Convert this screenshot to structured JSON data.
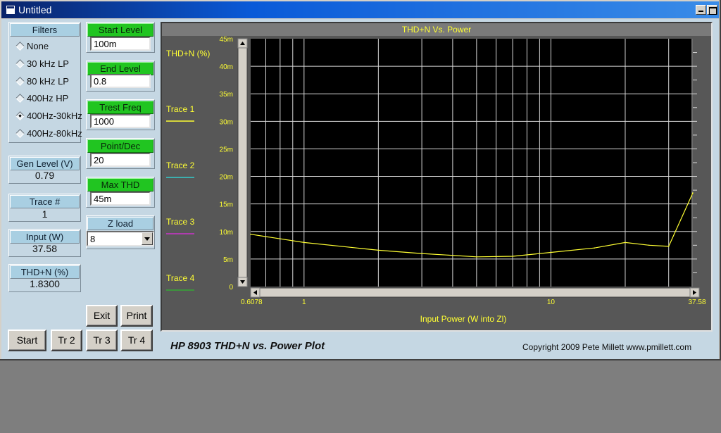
{
  "window": {
    "title": "Untitled"
  },
  "filters": {
    "label": "Filters",
    "options": [
      {
        "label": "None",
        "selected": false
      },
      {
        "label": "30 kHz LP",
        "selected": false
      },
      {
        "label": "80 kHz LP",
        "selected": false
      },
      {
        "label": "400Hz HP",
        "selected": false
      },
      {
        "label": "400Hz-30kHz",
        "selected": true
      },
      {
        "label": "400Hz-80kHz",
        "selected": false
      }
    ]
  },
  "readouts": {
    "gen_level": {
      "label": "Gen Level (V)",
      "value": "0.79"
    },
    "trace_num": {
      "label": "Trace #",
      "value": "1"
    },
    "input_w": {
      "label": "Input (W)",
      "value": "37.58"
    },
    "thdn": {
      "label": "THD+N (%)",
      "value": "1.8300"
    }
  },
  "params": {
    "start_level": {
      "label": "Start Level",
      "value": "100m"
    },
    "end_level": {
      "label": "End Level",
      "value": "0.8"
    },
    "test_freq": {
      "label": "Trest Freq",
      "value": "1000"
    },
    "point_dec": {
      "label": "Point/Dec",
      "value": "20"
    },
    "max_thd": {
      "label": "Max THD",
      "value": "45m"
    },
    "z_load": {
      "label": "Z load",
      "value": "8"
    }
  },
  "buttons": {
    "exit": "Exit",
    "print": "Print",
    "start": "Start",
    "tr2": "Tr 2",
    "tr3": "Tr 3",
    "tr4": "Tr 4"
  },
  "footer": {
    "title": "HP 8903 THD+N vs. Power Plot",
    "copyright": "Copyright 2009 Pete Millett    www.pmillett.com"
  },
  "chart_data": {
    "type": "line",
    "title": "THD+N Vs. Power",
    "ylabel": "THD+N (%)",
    "xlabel": "Input Power (W into Zl)",
    "x_scale": "log",
    "xlim": [
      0.6078,
      37.58
    ],
    "ylim": [
      0,
      45
    ],
    "y_ticks": [
      "0",
      "5m",
      "10m",
      "15m",
      "20m",
      "25m",
      "30m",
      "35m",
      "40m",
      "45m"
    ],
    "x_tick_labels": [
      {
        "value": 0.6078,
        "label": "0.6078"
      },
      {
        "value": 1,
        "label": "1"
      },
      {
        "value": 10,
        "label": "10"
      },
      {
        "value": 37.58,
        "label": "37.58"
      }
    ],
    "grid": true,
    "legend": [
      {
        "name": "Trace 1",
        "color": "#ffff33"
      },
      {
        "name": "Trace 2",
        "color": "#33cccc"
      },
      {
        "name": "Trace 3",
        "color": "#cc33cc"
      },
      {
        "name": "Trace 4",
        "color": "#33aa33"
      }
    ],
    "series": [
      {
        "name": "Trace 1",
        "color": "#ffff33",
        "x": [
          0.6078,
          1.0,
          2.0,
          3.0,
          5.0,
          7.0,
          10.0,
          15.0,
          20.0,
          25.0,
          30.0,
          37.58
        ],
        "y": [
          9.5,
          8.0,
          6.6,
          6.0,
          5.4,
          5.5,
          6.2,
          7.0,
          8.0,
          7.5,
          7.3,
          17.0
        ]
      }
    ],
    "colors": {
      "background": "#000000",
      "grid": "#d8d8d8",
      "text": "#ffff33"
    }
  }
}
